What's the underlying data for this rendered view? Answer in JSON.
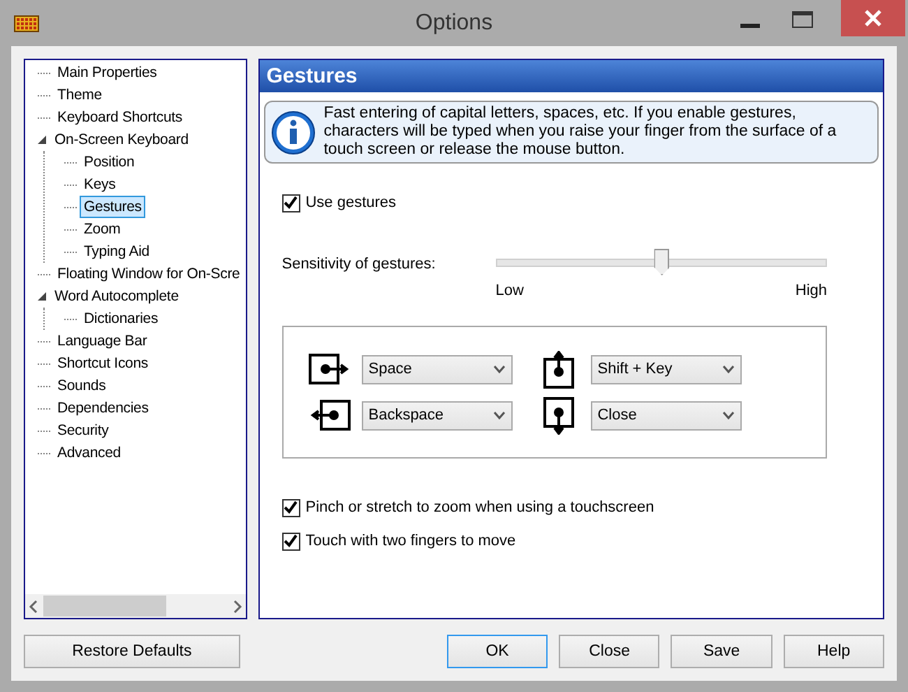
{
  "window": {
    "title": "Options"
  },
  "tree": [
    {
      "label": "Main Properties",
      "selected": false
    },
    {
      "label": "Theme",
      "selected": false
    },
    {
      "label": "Keyboard Shortcuts",
      "selected": false
    },
    {
      "label": "On-Screen Keyboard",
      "selected": false,
      "expanded": true,
      "children": [
        {
          "label": "Position",
          "selected": false
        },
        {
          "label": "Keys",
          "selected": false
        },
        {
          "label": "Gestures",
          "selected": true
        },
        {
          "label": "Zoom",
          "selected": false
        },
        {
          "label": "Typing Aid",
          "selected": false
        }
      ]
    },
    {
      "label": "Floating Window for On-Scre",
      "selected": false
    },
    {
      "label": "Word Autocomplete",
      "selected": false,
      "expanded": true,
      "children": [
        {
          "label": "Dictionaries",
          "selected": false
        }
      ]
    },
    {
      "label": "Language Bar",
      "selected": false
    },
    {
      "label": "Shortcut Icons",
      "selected": false
    },
    {
      "label": "Sounds",
      "selected": false
    },
    {
      "label": "Dependencies",
      "selected": false
    },
    {
      "label": "Security",
      "selected": false
    },
    {
      "label": "Advanced",
      "selected": false
    }
  ],
  "panel": {
    "title": "Gestures",
    "info": "Fast entering of capital letters, spaces, etc. If you enable gestures, characters will be typed when you raise your finger from the surface of a touch screen or release the mouse button.",
    "use_gestures": {
      "label": "Use gestures",
      "checked": true
    },
    "sensitivity": {
      "label": "Sensitivity of gestures:",
      "level": 0.5,
      "low": "Low",
      "high": "High"
    },
    "mappings": [
      {
        "kind": "right",
        "value": "Space"
      },
      {
        "kind": "up",
        "value": "Shift + Key"
      },
      {
        "kind": "left",
        "value": "Backspace"
      },
      {
        "kind": "down",
        "value": "Close"
      }
    ],
    "options": [
      {
        "label": "Pinch or stretch to zoom when using a touchscreen",
        "checked": true
      },
      {
        "label": "Touch with two fingers to move",
        "checked": true
      }
    ]
  },
  "buttons": [
    {
      "label": "Restore Defaults",
      "focused": false
    },
    {
      "label": "OK",
      "focused": true
    },
    {
      "label": "Close",
      "focused": false
    },
    {
      "label": "Save",
      "focused": false
    },
    {
      "label": "Help",
      "focused": false
    }
  ]
}
